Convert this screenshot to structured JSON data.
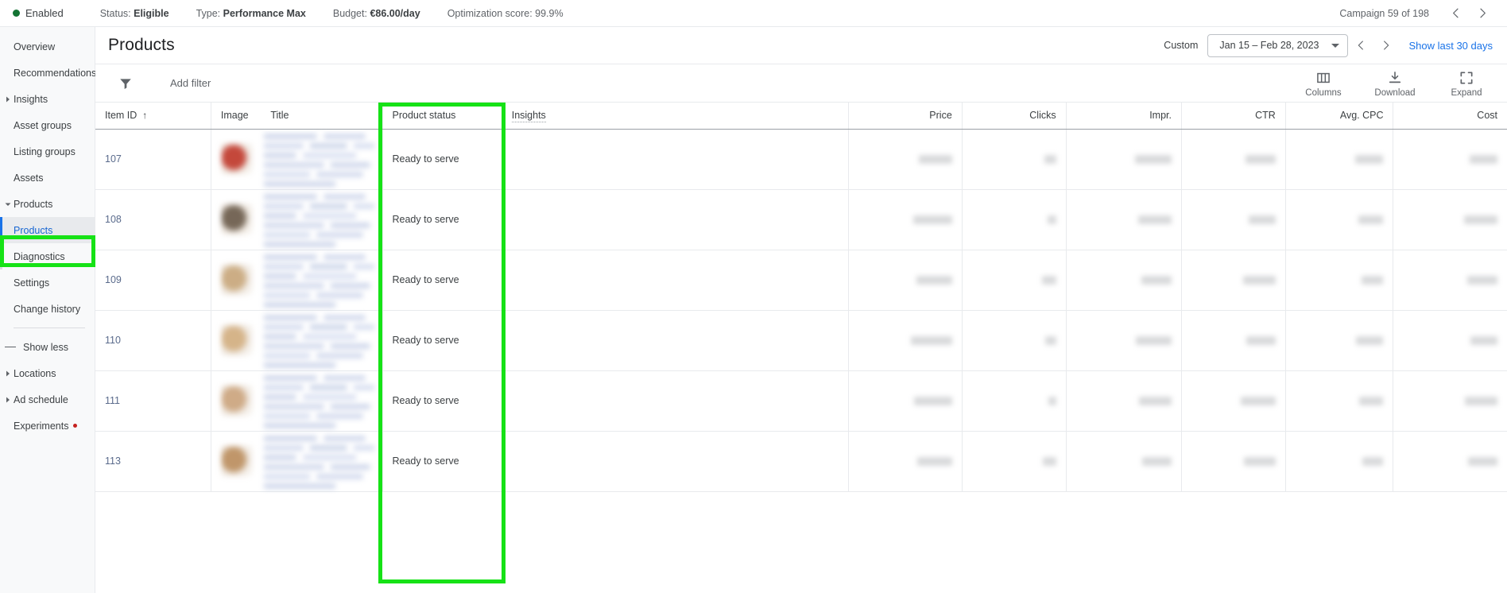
{
  "topbar": {
    "enabled_label": "Enabled",
    "status_key": "Status:",
    "status_value": "Eligible",
    "type_key": "Type:",
    "type_value": "Performance Max",
    "budget_key": "Budget:",
    "budget_value": "€86.00/day",
    "optimization_key": "Optimization score:",
    "optimization_value": "99.9%",
    "campaign_count": "Campaign 59 of 198",
    "prev_icon": "chevron-left-icon",
    "next_icon": "chevron-right-icon",
    "status_dot_color": "#137333"
  },
  "sidebar": {
    "items": [
      {
        "label": "Overview",
        "expandable": false,
        "child": false,
        "active": false,
        "dot": false
      },
      {
        "label": "Recommendations",
        "expandable": false,
        "child": false,
        "active": false,
        "dot": false
      },
      {
        "label": "Insights",
        "expandable": true,
        "child": false,
        "active": false,
        "dot": false,
        "expanded": false
      },
      {
        "label": "Asset groups",
        "expandable": false,
        "child": false,
        "active": false,
        "dot": false
      },
      {
        "label": "Listing groups",
        "expandable": false,
        "child": false,
        "active": false,
        "dot": false
      },
      {
        "label": "Assets",
        "expandable": false,
        "child": false,
        "active": false,
        "dot": false
      },
      {
        "label": "Products",
        "expandable": true,
        "child": false,
        "active": false,
        "dot": false,
        "expanded": true
      },
      {
        "label": "Products",
        "expandable": false,
        "child": true,
        "active": true,
        "dot": false
      },
      {
        "label": "Diagnostics",
        "expandable": false,
        "child": true,
        "active": false,
        "dot": false
      },
      {
        "label": "Settings",
        "expandable": false,
        "child": false,
        "active": false,
        "dot": false
      },
      {
        "label": "Change history",
        "expandable": false,
        "child": false,
        "active": false,
        "dot": false
      }
    ],
    "show_less": "Show less",
    "items_after": [
      {
        "label": "Locations",
        "expandable": true,
        "active": false,
        "dot": false
      },
      {
        "label": "Ad schedule",
        "expandable": true,
        "active": false,
        "dot": false
      },
      {
        "label": "Experiments",
        "expandable": false,
        "active": false,
        "dot": true
      }
    ]
  },
  "header": {
    "title": "Products",
    "custom_label": "Custom",
    "date_range": "Jan 15 – Feb 28, 2023",
    "prev_icon": "chevron-left-icon",
    "next_icon": "chevron-right-icon",
    "show_last_30": "Show last 30 days"
  },
  "toolbar": {
    "filter_icon": "funnel-icon",
    "add_filter": "Add filter",
    "actions": [
      {
        "label": "Columns",
        "icon": "columns-icon"
      },
      {
        "label": "Download",
        "icon": "download-icon"
      },
      {
        "label": "Expand",
        "icon": "expand-icon"
      }
    ]
  },
  "table": {
    "columns": [
      {
        "key": "item_id",
        "label": "Item ID",
        "align": "left",
        "sorted": true,
        "sort_dir": "asc"
      },
      {
        "key": "image",
        "label": "Image",
        "align": "left"
      },
      {
        "key": "title",
        "label": "Title",
        "align": "left"
      },
      {
        "key": "product_status",
        "label": "Product status",
        "align": "left",
        "highlighted": true
      },
      {
        "key": "insights",
        "label": "Insights",
        "align": "left",
        "tooltip": true
      },
      {
        "key": "price",
        "label": "Price",
        "align": "right"
      },
      {
        "key": "clicks",
        "label": "Clicks",
        "align": "right"
      },
      {
        "key": "impr",
        "label": "Impr.",
        "align": "right"
      },
      {
        "key": "ctr",
        "label": "CTR",
        "align": "right"
      },
      {
        "key": "avg_cpc",
        "label": "Avg. CPC",
        "align": "right"
      },
      {
        "key": "cost",
        "label": "Cost",
        "align": "right"
      }
    ],
    "rows": [
      {
        "item_id": "107",
        "product_status": "Ready to serve",
        "redacted": true,
        "thumb_color": "#c0392b"
      },
      {
        "item_id": "108",
        "product_status": "Ready to serve",
        "redacted": true,
        "thumb_color": "#6b5b4a"
      },
      {
        "item_id": "109",
        "product_status": "Ready to serve",
        "redacted": true,
        "thumb_color": "#c8a77b"
      },
      {
        "item_id": "110",
        "product_status": "Ready to serve",
        "redacted": true,
        "thumb_color": "#d2ae80"
      },
      {
        "item_id": "111",
        "product_status": "Ready to serve",
        "redacted": true,
        "thumb_color": "#cba47d"
      },
      {
        "item_id": "113",
        "product_status": "Ready to serve",
        "redacted": true,
        "thumb_color": "#bb8e5e"
      }
    ],
    "sort_arrow": "↑"
  },
  "annotations": {
    "highlight_color": "#16e216",
    "column_box": "product-status-column",
    "sidebar_box": "sidebar-products-item"
  }
}
